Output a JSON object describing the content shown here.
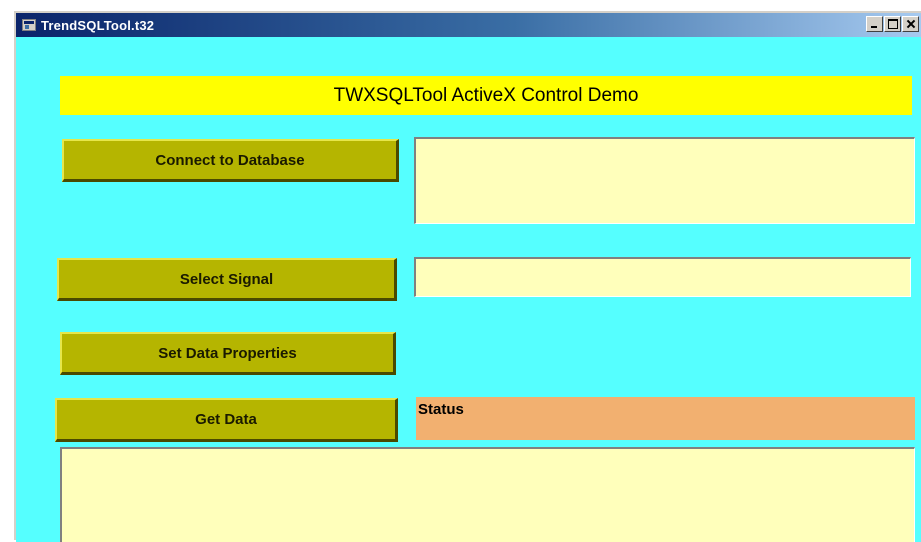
{
  "window": {
    "title": "TrendSQLTool.t32"
  },
  "banner": {
    "text": "TWXSQLTool ActiveX Control Demo"
  },
  "buttons": {
    "connect": "Connect to Database",
    "select_signal": "Select Signal",
    "set_data_properties": "Set Data Properties",
    "get_data": "Get Data"
  },
  "status": {
    "label": "Status"
  },
  "colors": {
    "client_background": "#55ffff",
    "banner": "#ffff00",
    "button": "#b5b500",
    "field": "#ffffbb",
    "status": "#f2b070",
    "titlebar": "#0a246a"
  }
}
